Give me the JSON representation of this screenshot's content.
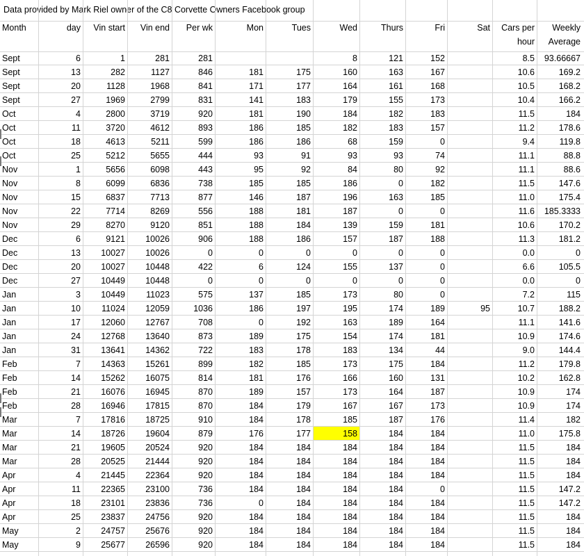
{
  "title": "Data provided by Mark Riel owner of the C8 Corvette Owners Facebook group",
  "headers": [
    {
      "key": "month",
      "label": "Month",
      "align": "l"
    },
    {
      "key": "day",
      "label": "day",
      "align": "r"
    },
    {
      "key": "vin_start",
      "label": "Vin start",
      "align": "r"
    },
    {
      "key": "vin_end",
      "label": "Vin end",
      "align": "r"
    },
    {
      "key": "per_wk",
      "label": "Per wk",
      "align": "r"
    },
    {
      "key": "mon",
      "label": "Mon",
      "align": "r"
    },
    {
      "key": "tues",
      "label": "Tues",
      "align": "r"
    },
    {
      "key": "wed",
      "label": "Wed",
      "align": "r"
    },
    {
      "key": "thurs",
      "label": "Thurs",
      "align": "r"
    },
    {
      "key": "fri",
      "label": "Fri",
      "align": "r"
    },
    {
      "key": "sat",
      "label": "Sat",
      "align": "r"
    },
    {
      "key": "cars_per_hour",
      "label": "Cars per hour",
      "align": "r"
    },
    {
      "key": "weekly_average",
      "label": "Weekly Average",
      "align": "r"
    }
  ],
  "highlight_color": "#ffff00",
  "highlighted_cell": {
    "row": 27,
    "col": 7
  },
  "rows": [
    [
      "Sept",
      "6",
      "1",
      "281",
      "281",
      "",
      "",
      "8",
      "121",
      "152",
      "",
      "8.5",
      "93.66667"
    ],
    [
      "Sept",
      "13",
      "282",
      "1127",
      "846",
      "181",
      "175",
      "160",
      "163",
      "167",
      "",
      "10.6",
      "169.2"
    ],
    [
      "Sept",
      "20",
      "1128",
      "1968",
      "841",
      "171",
      "177",
      "164",
      "161",
      "168",
      "",
      "10.5",
      "168.2"
    ],
    [
      "Sept",
      "27",
      "1969",
      "2799",
      "831",
      "141",
      "183",
      "179",
      "155",
      "173",
      "",
      "10.4",
      "166.2"
    ],
    [
      "Oct",
      "4",
      "2800",
      "3719",
      "920",
      "181",
      "190",
      "184",
      "182",
      "183",
      "",
      "11.5",
      "184"
    ],
    [
      "Oct",
      "11",
      "3720",
      "4612",
      "893",
      "186",
      "185",
      "182",
      "183",
      "157",
      "",
      "11.2",
      "178.6"
    ],
    [
      "Oct",
      "18",
      "4613",
      "5211",
      "599",
      "186",
      "186",
      "68",
      "159",
      "0",
      "",
      "9.4",
      "119.8"
    ],
    [
      "Oct",
      "25",
      "5212",
      "5655",
      "444",
      "93",
      "91",
      "93",
      "93",
      "74",
      "",
      "11.1",
      "88.8"
    ],
    [
      "Nov",
      "1",
      "5656",
      "6098",
      "443",
      "95",
      "92",
      "84",
      "80",
      "92",
      "",
      "11.1",
      "88.6"
    ],
    [
      "Nov",
      "8",
      "6099",
      "6836",
      "738",
      "185",
      "185",
      "186",
      "0",
      "182",
      "",
      "11.5",
      "147.6"
    ],
    [
      "Nov",
      "15",
      "6837",
      "7713",
      "877",
      "146",
      "187",
      "196",
      "163",
      "185",
      "",
      "11.0",
      "175.4"
    ],
    [
      "Nov",
      "22",
      "7714",
      "8269",
      "556",
      "188",
      "181",
      "187",
      "0",
      "0",
      "",
      "11.6",
      "185.3333"
    ],
    [
      "Nov",
      "29",
      "8270",
      "9120",
      "851",
      "188",
      "184",
      "139",
      "159",
      "181",
      "",
      "10.6",
      "170.2"
    ],
    [
      "Dec",
      "6",
      "9121",
      "10026",
      "906",
      "188",
      "186",
      "157",
      "187",
      "188",
      "",
      "11.3",
      "181.2"
    ],
    [
      "Dec",
      "13",
      "10027",
      "10026",
      "0",
      "0",
      "0",
      "0",
      "0",
      "0",
      "",
      "0.0",
      "0"
    ],
    [
      "Dec",
      "20",
      "10027",
      "10448",
      "422",
      "6",
      "124",
      "155",
      "137",
      "0",
      "",
      "6.6",
      "105.5"
    ],
    [
      "Dec",
      "27",
      "10449",
      "10448",
      "0",
      "0",
      "0",
      "0",
      "0",
      "0",
      "",
      "0.0",
      "0"
    ],
    [
      "Jan",
      "3",
      "10449",
      "11023",
      "575",
      "137",
      "185",
      "173",
      "80",
      "0",
      "",
      "7.2",
      "115"
    ],
    [
      "Jan",
      "10",
      "11024",
      "12059",
      "1036",
      "186",
      "197",
      "195",
      "174",
      "189",
      "95",
      "10.7",
      "188.2"
    ],
    [
      "Jan",
      "17",
      "12060",
      "12767",
      "708",
      "0",
      "192",
      "163",
      "189",
      "164",
      "",
      "11.1",
      "141.6"
    ],
    [
      "Jan",
      "24",
      "12768",
      "13640",
      "873",
      "189",
      "175",
      "154",
      "174",
      "181",
      "",
      "10.9",
      "174.6"
    ],
    [
      "Jan",
      "31",
      "13641",
      "14362",
      "722",
      "183",
      "178",
      "183",
      "134",
      "44",
      "",
      "9.0",
      "144.4"
    ],
    [
      "Feb",
      "7",
      "14363",
      "15261",
      "899",
      "182",
      "185",
      "173",
      "175",
      "184",
      "",
      "11.2",
      "179.8"
    ],
    [
      "Feb",
      "14",
      "15262",
      "16075",
      "814",
      "181",
      "176",
      "166",
      "160",
      "131",
      "",
      "10.2",
      "162.8"
    ],
    [
      "Feb",
      "21",
      "16076",
      "16945",
      "870",
      "189",
      "157",
      "173",
      "164",
      "187",
      "",
      "10.9",
      "174"
    ],
    [
      "Feb",
      "28",
      "16946",
      "17815",
      "870",
      "184",
      "179",
      "167",
      "167",
      "173",
      "",
      "10.9",
      "174"
    ],
    [
      "Mar",
      "7",
      "17816",
      "18725",
      "910",
      "184",
      "178",
      "185",
      "187",
      "176",
      "",
      "11.4",
      "182"
    ],
    [
      "Mar",
      "14",
      "18726",
      "19604",
      "879",
      "176",
      "177",
      "158",
      "184",
      "184",
      "",
      "11.0",
      "175.8"
    ],
    [
      "Mar",
      "21",
      "19605",
      "20524",
      "920",
      "184",
      "184",
      "184",
      "184",
      "184",
      "",
      "11.5",
      "184"
    ],
    [
      "Mar",
      "28",
      "20525",
      "21444",
      "920",
      "184",
      "184",
      "184",
      "184",
      "184",
      "",
      "11.5",
      "184"
    ],
    [
      "Apr",
      "4",
      "21445",
      "22364",
      "920",
      "184",
      "184",
      "184",
      "184",
      "184",
      "",
      "11.5",
      "184"
    ],
    [
      "Apr",
      "11",
      "22365",
      "23100",
      "736",
      "184",
      "184",
      "184",
      "184",
      "0",
      "",
      "11.5",
      "147.2"
    ],
    [
      "Apr",
      "18",
      "23101",
      "23836",
      "736",
      "0",
      "184",
      "184",
      "184",
      "184",
      "",
      "11.5",
      "147.2"
    ],
    [
      "Apr",
      "25",
      "23837",
      "24756",
      "920",
      "184",
      "184",
      "184",
      "184",
      "184",
      "",
      "11.5",
      "184"
    ],
    [
      "May",
      "2",
      "24757",
      "25676",
      "920",
      "184",
      "184",
      "184",
      "184",
      "184",
      "",
      "11.5",
      "184"
    ],
    [
      "May",
      "9",
      "25677",
      "26596",
      "920",
      "184",
      "184",
      "184",
      "184",
      "184",
      "",
      "11.5",
      "184"
    ]
  ]
}
